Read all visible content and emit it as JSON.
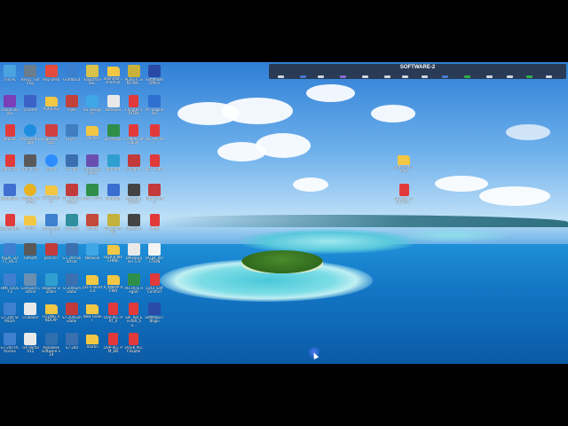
{
  "toolbar": {
    "title": "SOFTWARE-2"
  },
  "colors": {
    "sky_top": "#2f7fd6",
    "sea": "#1275c4",
    "toolbar_bg": "#28344a",
    "cursor": "#5078ff"
  },
  "icons": [
    {
      "label": "This PC",
      "icon": "computer-icon",
      "color": "#4aa3df"
    },
    {
      "label": "Recyc. Soft.Eq.",
      "icon": "recycle-bin-icon",
      "color": "#6b7d8c"
    },
    {
      "label": "Any Desk",
      "icon": "anydesk-icon",
      "color": "#e54b3c"
    },
    {
      "label": "Grafikal.it",
      "icon": "app-icon",
      "color": "#3a7fd0"
    },
    {
      "label": "EduOffice Sec.",
      "icon": "app-icon",
      "color": "#d8c24a"
    },
    {
      "label": "Rahnmet... shortcut",
      "icon": "folder-icon",
      "color": "#f2c744"
    },
    {
      "label": "PLASTIC ENT-MA...",
      "icon": "app-icon",
      "color": "#c9b13b"
    },
    {
      "label": "SoftMaker Office",
      "icon": "app-icon",
      "color": "#2a4aa8"
    },
    {
      "label": "Visual Studio",
      "icon": "app-icon",
      "color": "#7a3fb8"
    },
    {
      "label": "Chrome",
      "icon": "app-icon",
      "color": "#3b63c7"
    },
    {
      "label": "AutoCAD",
      "icon": "folder-icon",
      "color": "#f2c744"
    },
    {
      "label": "Vijeo",
      "icon": "app-icon",
      "color": "#c2413a"
    },
    {
      "label": "XS Designer",
      "icon": "xs-icon",
      "color": "#3fa7e6"
    },
    {
      "label": "Notepad",
      "icon": "doc-icon",
      "color": "#e9e9e9"
    },
    {
      "label": "Chapter-1 FATEK",
      "icon": "pdf-icon",
      "color": "#e23a3a"
    },
    {
      "label": "PC Engine Ver",
      "icon": "app-icon",
      "color": "#2f6fd0"
    },
    {
      "label": "Intouch",
      "icon": "pdf-icon",
      "color": "#e23a3a"
    },
    {
      "label": "Microsoft Edge",
      "icon": "edge-icon",
      "color": "#1e8de0"
    },
    {
      "label": "Engineer Tools",
      "icon": "app-icon",
      "color": "#d04040"
    },
    {
      "label": "STEP 7",
      "icon": "app-icon",
      "color": "#3f7fc0"
    },
    {
      "label": "Utilities",
      "icon": "folder-icon",
      "color": "#f2c744"
    },
    {
      "label": "Electronic",
      "icon": "app-icon",
      "color": "#2f8f4a"
    },
    {
      "label": "FieldPLC Module",
      "icon": "pdf-icon",
      "color": "#e23a3a"
    },
    {
      "label": "PLC Pro Ver",
      "icon": "pdf-icon",
      "color": "#e23a3a"
    },
    {
      "label": "pdf-2019",
      "icon": "pdf-icon",
      "color": "#e23a3a"
    },
    {
      "label": "Rhino-Tec",
      "icon": "app-icon",
      "color": "#5a5a5a"
    },
    {
      "label": "Zoom",
      "icon": "zoom-icon",
      "color": "#2d8cff"
    },
    {
      "label": "S7 300",
      "icon": "app-icon",
      "color": "#3a6fb0"
    },
    {
      "label": "Project Explorer",
      "icon": "app-icon",
      "color": "#6a4fb0"
    },
    {
      "label": "Remote",
      "icon": "app-icon",
      "color": "#2f9fd0"
    },
    {
      "label": "Configur...",
      "icon": "app-icon",
      "color": "#c23a3a"
    },
    {
      "label": "PLC-Editor",
      "icon": "pdf-icon",
      "color": "#e23a3a"
    },
    {
      "label": "SoftMaker",
      "icon": "app-icon",
      "color": "#3f6fd0"
    },
    {
      "label": "Google Chrome",
      "icon": "chrome-icon",
      "color": "#e8b323"
    },
    {
      "label": "XS Designer",
      "icon": "folder-icon",
      "color": "#f2c744"
    },
    {
      "label": "ST_300 Shortcut",
      "icon": "app-icon",
      "color": "#c23a3a"
    },
    {
      "label": "EASY SOFT",
      "icon": "app-icon",
      "color": "#2f8f4a"
    },
    {
      "label": "Runtime",
      "icon": "app-icon",
      "color": "#3a6fd0"
    },
    {
      "label": "Automat. Studio",
      "icon": "app-icon",
      "color": "#444"
    },
    {
      "label": "Pdp Screen",
      "icon": "app-icon",
      "color": "#c23a3a"
    },
    {
      "label": "DeviceFacl",
      "icon": "pdf-icon",
      "color": "#e23a3a"
    },
    {
      "label": "Media",
      "icon": "folder-icon",
      "color": "#f2c744"
    },
    {
      "label": "Connection",
      "icon": "app-icon",
      "color": "#3f7fd0"
    },
    {
      "label": "TIA Port",
      "icon": "app-icon",
      "color": "#2f8f9f"
    },
    {
      "label": "WinCC",
      "icon": "app-icon",
      "color": "#c24a3a"
    },
    {
      "label": "TOOLS for PC",
      "icon": "app-icon",
      "color": "#c2b13b"
    },
    {
      "label": "FatekPLC",
      "icon": "app-icon",
      "color": "#444"
    },
    {
      "label": "Fatek",
      "icon": "pdf-icon",
      "color": "#e23a3a"
    },
    {
      "label": "ASDA_SO FT_V6.3",
      "icon": "app-icon",
      "color": "#3f7fd0"
    },
    {
      "label": "ISPSoft",
      "icon": "app-icon",
      "color": "#5a5a5a"
    },
    {
      "label": "plcs-scr",
      "icon": "app-icon",
      "color": "#c23a3a"
    },
    {
      "label": "ST_200 Shortcut",
      "icon": "app-icon",
      "color": "#3a6fb0"
    },
    {
      "label": "Network",
      "icon": "network-icon",
      "color": "#3fa7e6"
    },
    {
      "label": "BLOCK MACHINE",
      "icon": "folder-icon",
      "color": "#f2c744"
    },
    {
      "label": "DIADesig ner 1.9",
      "icon": "app-icon",
      "color": "#e9e9e9"
    },
    {
      "label": "FATEK_IN ICTION",
      "icon": "doc-icon",
      "color": "#f4f4f4"
    },
    {
      "label": "HMI TOOL 7.1",
      "icon": "app-icon",
      "color": "#3f7fd0"
    },
    {
      "label": "Compact Control",
      "icon": "app-icon",
      "color": "#6a8fb0"
    },
    {
      "label": "Register Builder",
      "icon": "app-icon",
      "color": "#2f9fd0"
    },
    {
      "label": "ST200Sim ulator",
      "icon": "app-icon",
      "color": "#3a6fb0"
    },
    {
      "label": "pcl-4 Shortcut",
      "icon": "folder-icon",
      "color": "#f2c744"
    },
    {
      "label": "A_KNPPP RCWR",
      "icon": "folder-icon",
      "color": "#f2c744"
    },
    {
      "label": "PLCFATE RegStr",
      "icon": "app-icon",
      "color": "#2f8f4a"
    },
    {
      "label": "LOGI_Soft Comfort",
      "icon": "pdf-icon",
      "color": "#e23a3a"
    },
    {
      "label": "S7-200 SIMULA",
      "icon": "app-icon",
      "color": "#3f7fd0"
    },
    {
      "label": "CCleaner",
      "icon": "app-icon",
      "color": "#e9e9e9"
    },
    {
      "label": "FILLING ANDCAP",
      "icon": "folder-icon",
      "color": "#f2c744"
    },
    {
      "label": "S7-200Sim ulator",
      "icon": "app-icon",
      "color": "#c23a3a"
    },
    {
      "label": "New Folder",
      "icon": "folder-icon",
      "color": "#f2c744"
    },
    {
      "label": "DVP-PLC-P RT_II",
      "icon": "pdf-icon",
      "color": "#e23a3a"
    },
    {
      "label": "Ser_Rel_E nvfoR_Se...",
      "icon": "pdf-icon",
      "color": "#e23a3a"
    },
    {
      "label": "SoftMake r Bilgin",
      "icon": "app-icon",
      "color": "#2a4aa8"
    },
    {
      "label": "S7-200 PC Access",
      "icon": "app-icon",
      "color": "#3f7fd0"
    },
    {
      "label": "TIA Portal V12",
      "icon": "app-icon",
      "color": "#e9e9e9"
    },
    {
      "label": "Autodesk software v19",
      "icon": "app-icon",
      "color": "#2f6fb0"
    },
    {
      "label": "S7-200",
      "icon": "app-icon",
      "color": "#3a6fb0"
    },
    {
      "label": "martin",
      "icon": "folder-icon",
      "color": "#f2c744"
    },
    {
      "label": "DVP-PLC PM_EN",
      "icon": "pdf-icon",
      "color": "#e23a3a"
    },
    {
      "label": "FATEK PLC Chapter",
      "icon": "pdf-icon",
      "color": "#e23a3a"
    }
  ],
  "right_icons": [
    {
      "label": "pdf-ri shortcut",
      "icon": "folder-icon",
      "color": "#f2c744"
    },
    {
      "label": "mn_bet_e iln_Elec...",
      "icon": "pdf-icon",
      "color": "#e23a3a"
    }
  ]
}
